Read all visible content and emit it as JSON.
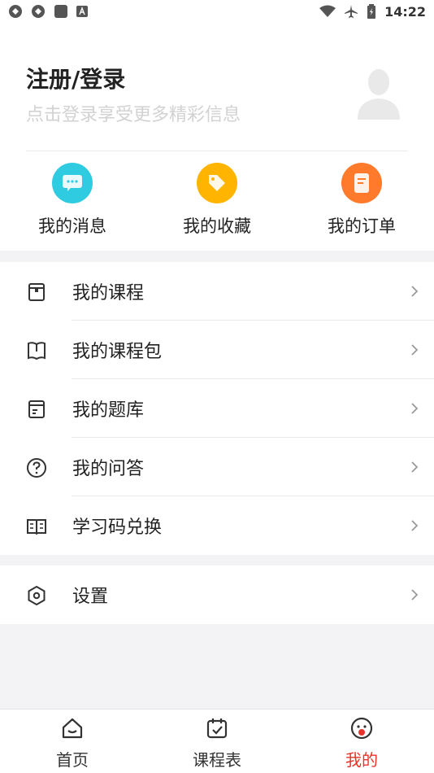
{
  "status_bar": {
    "time": "14:22"
  },
  "profile": {
    "title": "注册/登录",
    "subtitle": "点击登录享受更多精彩信息"
  },
  "quick_actions": [
    {
      "label": "我的消息",
      "icon": "message-icon",
      "color": "#2fcbe0"
    },
    {
      "label": "我的收藏",
      "icon": "favorite-tag-icon",
      "color": "#ffb400"
    },
    {
      "label": "我的订单",
      "icon": "order-icon",
      "color": "#ff7a2b"
    }
  ],
  "menu": [
    {
      "label": "我的课程",
      "icon": "course-icon"
    },
    {
      "label": "我的课程包",
      "icon": "book-icon"
    },
    {
      "label": "我的题库",
      "icon": "question-bank-icon"
    },
    {
      "label": "我的问答",
      "icon": "question-mark-icon"
    },
    {
      "label": "学习码兑换",
      "icon": "open-book-icon"
    }
  ],
  "settings": {
    "label": "设置",
    "icon": "settings-icon"
  },
  "tabbar": [
    {
      "label": "首页",
      "icon": "home-icon",
      "active": false
    },
    {
      "label": "课程表",
      "icon": "calendar-icon",
      "active": false
    },
    {
      "label": "我的",
      "icon": "profile-face-icon",
      "active": true
    }
  ],
  "colors": {
    "accent": "#e8332a",
    "text": "#222222",
    "muted": "#d2d2d2"
  }
}
